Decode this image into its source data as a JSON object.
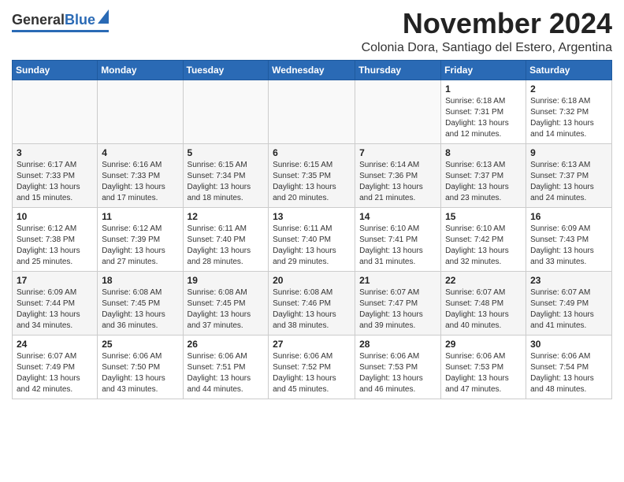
{
  "header": {
    "logo_general": "General",
    "logo_blue": "Blue",
    "month_title": "November 2024",
    "subtitle": "Colonia Dora, Santiago del Estero, Argentina"
  },
  "days_of_week": [
    "Sunday",
    "Monday",
    "Tuesday",
    "Wednesday",
    "Thursday",
    "Friday",
    "Saturday"
  ],
  "weeks": [
    [
      {
        "day": "",
        "info": ""
      },
      {
        "day": "",
        "info": ""
      },
      {
        "day": "",
        "info": ""
      },
      {
        "day": "",
        "info": ""
      },
      {
        "day": "",
        "info": ""
      },
      {
        "day": "1",
        "info": "Sunrise: 6:18 AM\nSunset: 7:31 PM\nDaylight: 13 hours and 12 minutes."
      },
      {
        "day": "2",
        "info": "Sunrise: 6:18 AM\nSunset: 7:32 PM\nDaylight: 13 hours and 14 minutes."
      }
    ],
    [
      {
        "day": "3",
        "info": "Sunrise: 6:17 AM\nSunset: 7:33 PM\nDaylight: 13 hours and 15 minutes."
      },
      {
        "day": "4",
        "info": "Sunrise: 6:16 AM\nSunset: 7:33 PM\nDaylight: 13 hours and 17 minutes."
      },
      {
        "day": "5",
        "info": "Sunrise: 6:15 AM\nSunset: 7:34 PM\nDaylight: 13 hours and 18 minutes."
      },
      {
        "day": "6",
        "info": "Sunrise: 6:15 AM\nSunset: 7:35 PM\nDaylight: 13 hours and 20 minutes."
      },
      {
        "day": "7",
        "info": "Sunrise: 6:14 AM\nSunset: 7:36 PM\nDaylight: 13 hours and 21 minutes."
      },
      {
        "day": "8",
        "info": "Sunrise: 6:13 AM\nSunset: 7:37 PM\nDaylight: 13 hours and 23 minutes."
      },
      {
        "day": "9",
        "info": "Sunrise: 6:13 AM\nSunset: 7:37 PM\nDaylight: 13 hours and 24 minutes."
      }
    ],
    [
      {
        "day": "10",
        "info": "Sunrise: 6:12 AM\nSunset: 7:38 PM\nDaylight: 13 hours and 25 minutes."
      },
      {
        "day": "11",
        "info": "Sunrise: 6:12 AM\nSunset: 7:39 PM\nDaylight: 13 hours and 27 minutes."
      },
      {
        "day": "12",
        "info": "Sunrise: 6:11 AM\nSunset: 7:40 PM\nDaylight: 13 hours and 28 minutes."
      },
      {
        "day": "13",
        "info": "Sunrise: 6:11 AM\nSunset: 7:40 PM\nDaylight: 13 hours and 29 minutes."
      },
      {
        "day": "14",
        "info": "Sunrise: 6:10 AM\nSunset: 7:41 PM\nDaylight: 13 hours and 31 minutes."
      },
      {
        "day": "15",
        "info": "Sunrise: 6:10 AM\nSunset: 7:42 PM\nDaylight: 13 hours and 32 minutes."
      },
      {
        "day": "16",
        "info": "Sunrise: 6:09 AM\nSunset: 7:43 PM\nDaylight: 13 hours and 33 minutes."
      }
    ],
    [
      {
        "day": "17",
        "info": "Sunrise: 6:09 AM\nSunset: 7:44 PM\nDaylight: 13 hours and 34 minutes."
      },
      {
        "day": "18",
        "info": "Sunrise: 6:08 AM\nSunset: 7:45 PM\nDaylight: 13 hours and 36 minutes."
      },
      {
        "day": "19",
        "info": "Sunrise: 6:08 AM\nSunset: 7:45 PM\nDaylight: 13 hours and 37 minutes."
      },
      {
        "day": "20",
        "info": "Sunrise: 6:08 AM\nSunset: 7:46 PM\nDaylight: 13 hours and 38 minutes."
      },
      {
        "day": "21",
        "info": "Sunrise: 6:07 AM\nSunset: 7:47 PM\nDaylight: 13 hours and 39 minutes."
      },
      {
        "day": "22",
        "info": "Sunrise: 6:07 AM\nSunset: 7:48 PM\nDaylight: 13 hours and 40 minutes."
      },
      {
        "day": "23",
        "info": "Sunrise: 6:07 AM\nSunset: 7:49 PM\nDaylight: 13 hours and 41 minutes."
      }
    ],
    [
      {
        "day": "24",
        "info": "Sunrise: 6:07 AM\nSunset: 7:49 PM\nDaylight: 13 hours and 42 minutes."
      },
      {
        "day": "25",
        "info": "Sunrise: 6:06 AM\nSunset: 7:50 PM\nDaylight: 13 hours and 43 minutes."
      },
      {
        "day": "26",
        "info": "Sunrise: 6:06 AM\nSunset: 7:51 PM\nDaylight: 13 hours and 44 minutes."
      },
      {
        "day": "27",
        "info": "Sunrise: 6:06 AM\nSunset: 7:52 PM\nDaylight: 13 hours and 45 minutes."
      },
      {
        "day": "28",
        "info": "Sunrise: 6:06 AM\nSunset: 7:53 PM\nDaylight: 13 hours and 46 minutes."
      },
      {
        "day": "29",
        "info": "Sunrise: 6:06 AM\nSunset: 7:53 PM\nDaylight: 13 hours and 47 minutes."
      },
      {
        "day": "30",
        "info": "Sunrise: 6:06 AM\nSunset: 7:54 PM\nDaylight: 13 hours and 48 minutes."
      }
    ]
  ]
}
